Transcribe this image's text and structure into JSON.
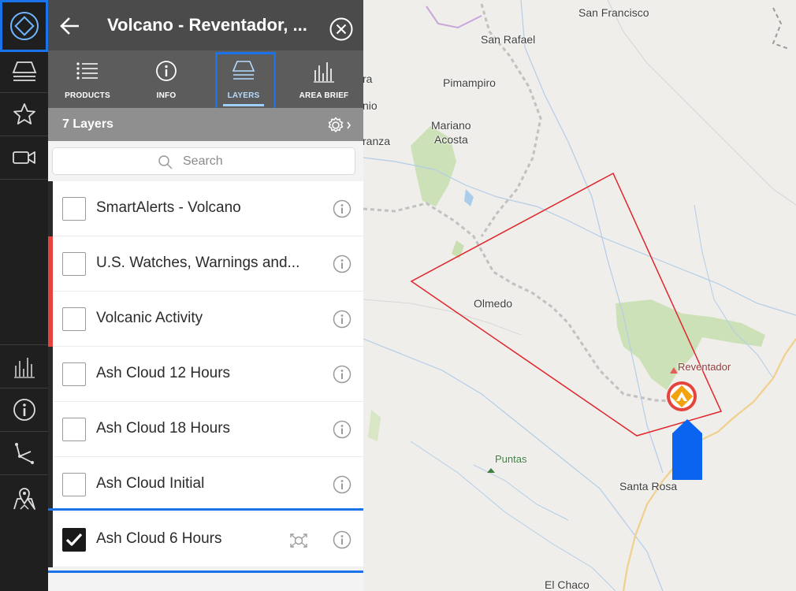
{
  "header": {
    "title": "Volcano - Reventador, ..."
  },
  "tabs": [
    {
      "label": "PRODUCTS",
      "icon": "list-icon"
    },
    {
      "label": "INFO",
      "icon": "info-icon"
    },
    {
      "label": "LAYERS",
      "icon": "layers-icon",
      "active": true
    },
    {
      "label": "AREA BRIEF",
      "icon": "bar-chart-icon"
    }
  ],
  "layers_panel": {
    "count_label": "7 Layers"
  },
  "search": {
    "placeholder": "Search"
  },
  "layers": [
    {
      "label": "SmartAlerts - Volcano",
      "checked": false,
      "bar_color": "#2a2a2a"
    },
    {
      "label": "U.S. Watches, Warnings and...",
      "checked": false,
      "bar_color": "#e5443c"
    },
    {
      "label": "Volcanic Activity",
      "checked": false,
      "bar_color": "#e5443c"
    },
    {
      "label": "Ash Cloud 12 Hours",
      "checked": false,
      "bar_color": "#2a2a2a"
    },
    {
      "label": "Ash Cloud 18 Hours",
      "checked": false,
      "bar_color": "#2a2a2a"
    },
    {
      "label": "Ash Cloud Initial",
      "checked": false,
      "bar_color": "#2a2a2a"
    },
    {
      "label": "Ash Cloud 6 Hours",
      "checked": true,
      "bar_color": "#2a2a2a"
    }
  ],
  "map": {
    "places": {
      "san_francisco": "San Francisco",
      "san_rafael": "San Rafael",
      "pimampiro": "Pimampiro",
      "mariano_acosta_1": "Mariano",
      "mariano_acosta_2": "Acosta",
      "olmedo": "Olmedo",
      "reventador": "Reventador",
      "puntas": "Puntas",
      "santa_rosa": "Santa Rosa",
      "el_chaco": "El Chaco",
      "edge_ra": "ra",
      "edge_nio": "nio",
      "edge_ranza": "ranza"
    }
  },
  "colors": {
    "accent": "#1a73e8",
    "alert_red": "#e5443c",
    "ash_polygon": "#e0262c",
    "marker_orange": "#f2a20c"
  }
}
